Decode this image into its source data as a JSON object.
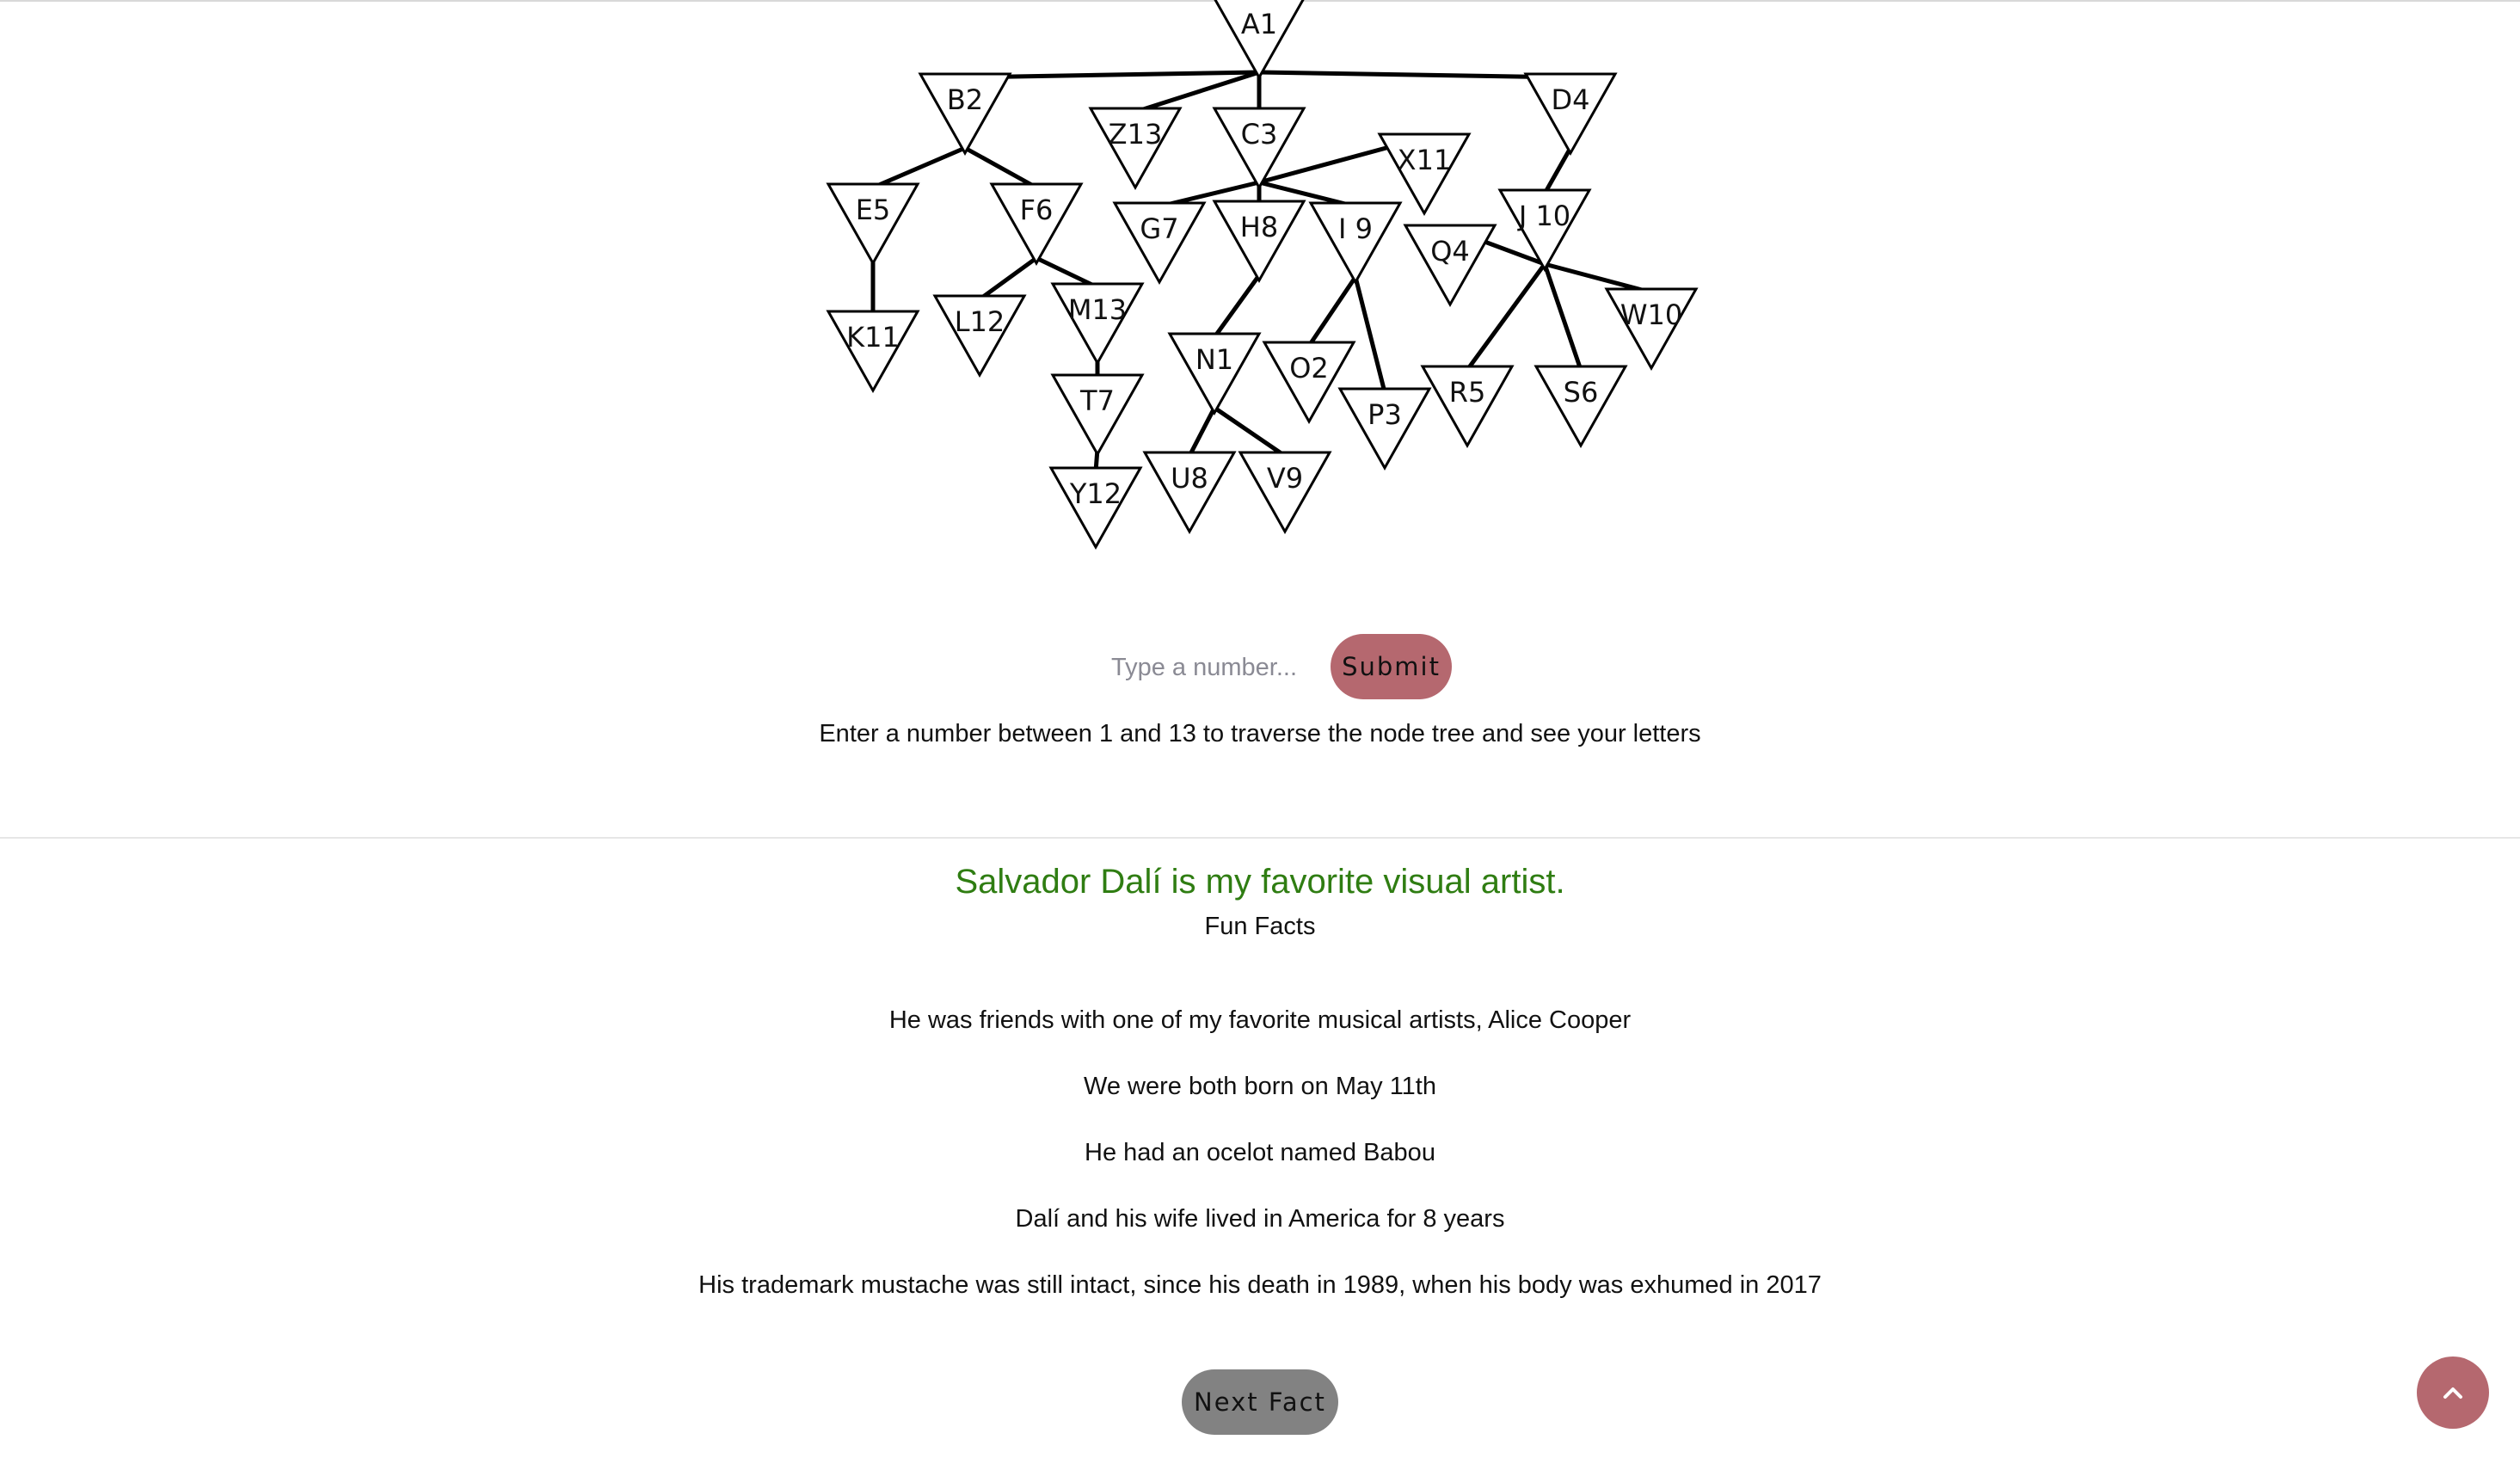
{
  "tree": {
    "nodes": [
      {
        "id": "A1",
        "label": "A1"
      },
      {
        "id": "B2",
        "label": "B2"
      },
      {
        "id": "Z13",
        "label": "Z13"
      },
      {
        "id": "C3",
        "label": "C3"
      },
      {
        "id": "D4",
        "label": "D4"
      },
      {
        "id": "X11",
        "label": "X11"
      },
      {
        "id": "E5",
        "label": "E5"
      },
      {
        "id": "F6",
        "label": "F6"
      },
      {
        "id": "G7",
        "label": "G7"
      },
      {
        "id": "H8",
        "label": "H8"
      },
      {
        "id": "I9",
        "label": "I 9"
      },
      {
        "id": "J10",
        "label": "J 10"
      },
      {
        "id": "Q4",
        "label": "Q4"
      },
      {
        "id": "W10",
        "label": "W10"
      },
      {
        "id": "K11",
        "label": "K11"
      },
      {
        "id": "L12",
        "label": "L12"
      },
      {
        "id": "M13",
        "label": "M13"
      },
      {
        "id": "N1",
        "label": "N1"
      },
      {
        "id": "O2",
        "label": "O2"
      },
      {
        "id": "P3",
        "label": "P3"
      },
      {
        "id": "R5",
        "label": "R5"
      },
      {
        "id": "S6",
        "label": "S6"
      },
      {
        "id": "T7",
        "label": "T7"
      },
      {
        "id": "U8",
        "label": "U8"
      },
      {
        "id": "V9",
        "label": "V9"
      },
      {
        "id": "Y12",
        "label": "Y12"
      }
    ],
    "edges": [
      [
        "A1",
        "B2"
      ],
      [
        "A1",
        "Z13"
      ],
      [
        "A1",
        "C3"
      ],
      [
        "A1",
        "D4"
      ],
      [
        "B2",
        "E5"
      ],
      [
        "B2",
        "F6"
      ],
      [
        "E5",
        "K11"
      ],
      [
        "F6",
        "L12"
      ],
      [
        "F6",
        "M13"
      ],
      [
        "M13",
        "T7"
      ],
      [
        "T7",
        "Y12"
      ],
      [
        "C3",
        "X11"
      ],
      [
        "C3",
        "G7"
      ],
      [
        "C3",
        "H8"
      ],
      [
        "C3",
        "I9"
      ],
      [
        "H8",
        "N1"
      ],
      [
        "N1",
        "U8"
      ],
      [
        "N1",
        "V9"
      ],
      [
        "I9",
        "O2"
      ],
      [
        "I9",
        "P3"
      ],
      [
        "D4",
        "J10"
      ],
      [
        "J10",
        "Q4"
      ],
      [
        "J10",
        "R5"
      ],
      [
        "J10",
        "S6"
      ],
      [
        "J10",
        "W10"
      ]
    ]
  },
  "form": {
    "placeholder": "Type a number...",
    "submit_label": "Submit",
    "instruction": "Enter a number between 1 and 13 to traverse the node tree and see your letters"
  },
  "artist": {
    "heading": "Salvador Dalí is my favorite visual artist.",
    "subheading": "Fun Facts",
    "facts": [
      "He was friends with one of my favorite musical artists, Alice Cooper",
      "We were both born on May 11th",
      "He had an ocelot named Babou",
      "Dalí and his wife lived in America for 8 years",
      "His trademark mustache was still intact, since his death in 1989, when his body was exhumed in 2017"
    ],
    "next_label": "Next Fact"
  },
  "scroll_top": {
    "icon": "chevron-up-icon"
  },
  "colors": {
    "heading_green": "#2f7d12",
    "submit_bg": "#b5686f",
    "next_bg": "#828282",
    "scroll_bg": "#b5686f",
    "divider": "#e6e6e6"
  }
}
